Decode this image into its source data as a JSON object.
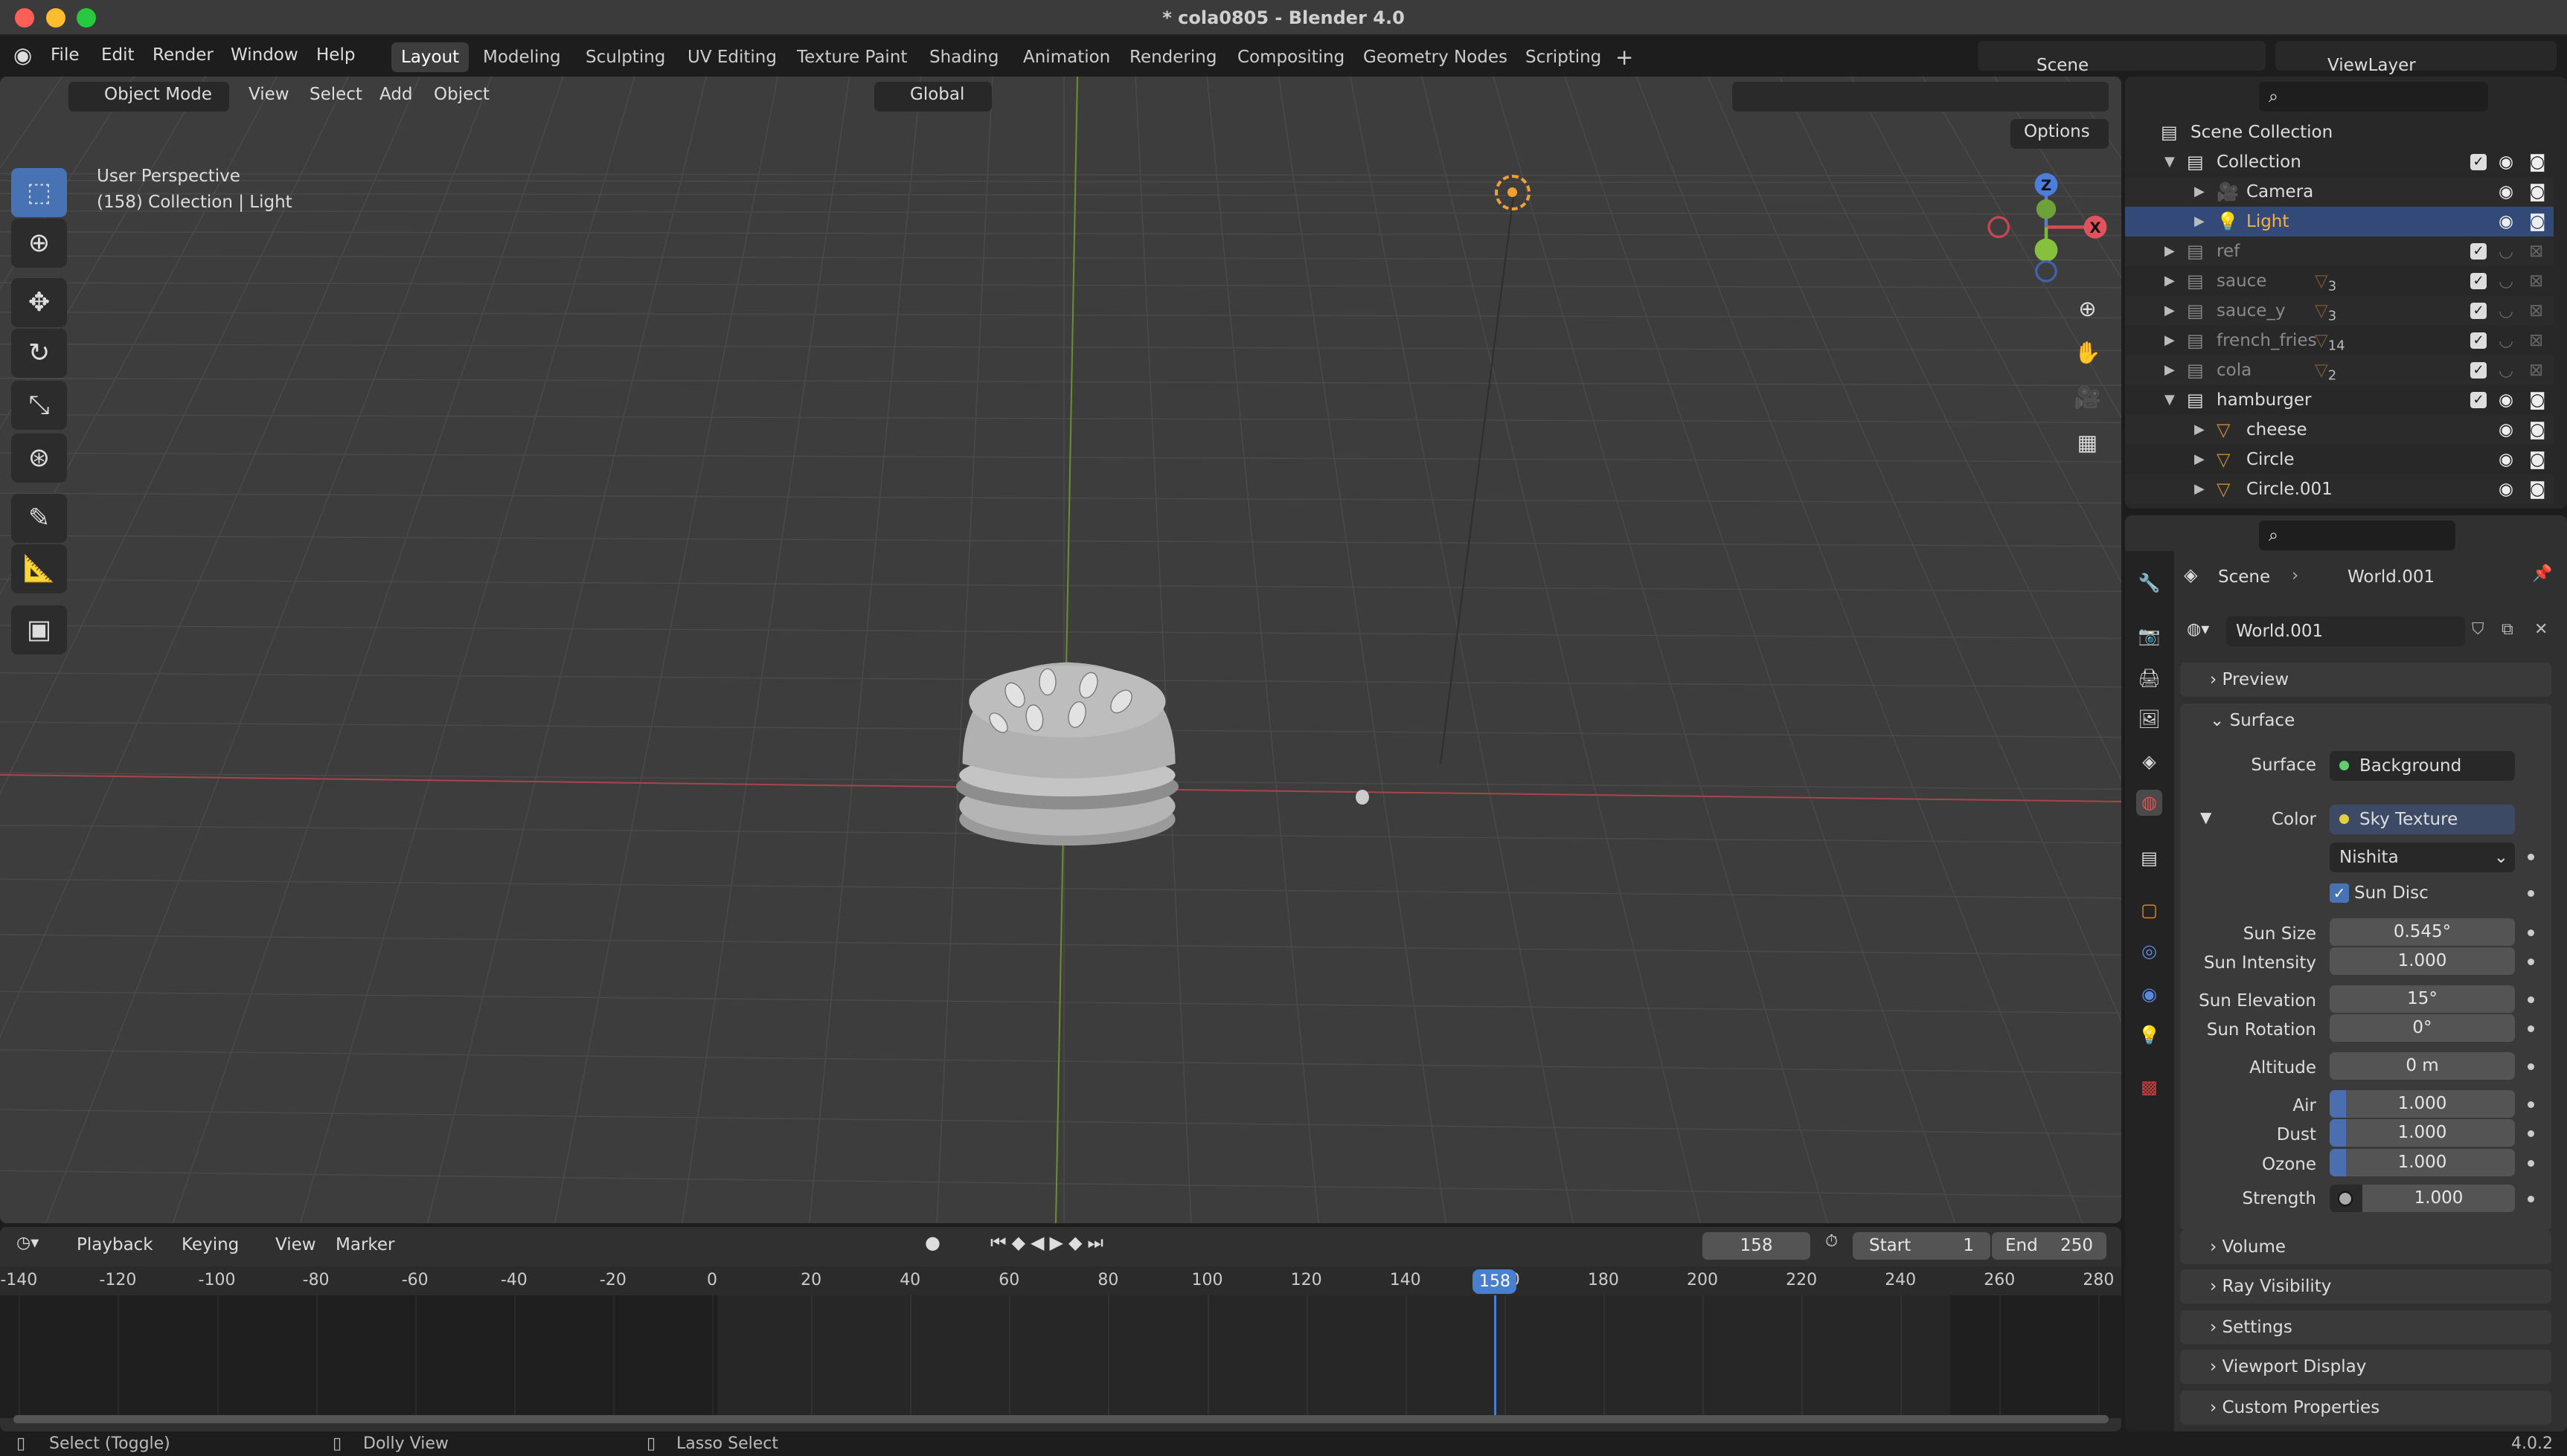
{
  "window": {
    "title": "* cola0805 - Blender 4.0",
    "traffic_lights": [
      "#ff5f57",
      "#febc2e",
      "#28c840"
    ]
  },
  "menu": {
    "items": [
      "File",
      "Edit",
      "Render",
      "Window",
      "Help"
    ],
    "workspaces": [
      "Layout",
      "Modeling",
      "Sculpting",
      "UV Editing",
      "Texture Paint",
      "Shading",
      "Animation",
      "Rendering",
      "Compositing",
      "Geometry Nodes",
      "Scripting"
    ],
    "active_workspace": "Layout",
    "add_workspace": "+",
    "scene": "Scene",
    "view_layer": "ViewLayer"
  },
  "viewport": {
    "mode": "Object Mode",
    "menus": [
      "View",
      "Select",
      "Add",
      "Object"
    ],
    "orientation": "Global",
    "options": "Options",
    "overlay_text": {
      "perspective": "User Perspective",
      "context": "(158) Collection | Light"
    },
    "gizmo": {
      "x": "X",
      "y": "Y",
      "z": "Z"
    },
    "tools": [
      "select-box",
      "cursor",
      "move",
      "rotate",
      "scale",
      "transform",
      "annotate",
      "measure",
      "add-cube"
    ]
  },
  "outliner": {
    "root": "Scene Collection",
    "rows": [
      {
        "name": "Collection",
        "type": "collection",
        "indent": 1,
        "expanded": true,
        "checked": true,
        "visible": true
      },
      {
        "name": "Camera",
        "type": "camera",
        "indent": 2,
        "visible": true
      },
      {
        "name": "Light",
        "type": "light",
        "indent": 2,
        "visible": true,
        "selected": true
      },
      {
        "name": "ref",
        "type": "collection",
        "indent": 1,
        "checked": true,
        "visible": false,
        "dim": true
      },
      {
        "name": "sauce",
        "type": "collection",
        "indent": 1,
        "checked": true,
        "visible": false,
        "dim": true,
        "count": "3"
      },
      {
        "name": "sauce_y",
        "type": "collection",
        "indent": 1,
        "checked": true,
        "visible": false,
        "dim": true,
        "count": "3"
      },
      {
        "name": "french_fries",
        "type": "collection",
        "indent": 1,
        "checked": true,
        "visible": false,
        "dim": true,
        "count": "14"
      },
      {
        "name": "cola",
        "type": "collection",
        "indent": 1,
        "checked": true,
        "visible": false,
        "dim": true,
        "count": "2"
      },
      {
        "name": "hamburger",
        "type": "collection",
        "indent": 1,
        "expanded": true,
        "checked": true,
        "visible": true
      },
      {
        "name": "cheese",
        "type": "mesh",
        "indent": 2,
        "visible": true
      },
      {
        "name": "Circle",
        "type": "mesh",
        "indent": 2,
        "visible": true
      },
      {
        "name": "Circle.001",
        "type": "mesh",
        "indent": 2,
        "visible": true
      }
    ]
  },
  "properties": {
    "breadcrumb": [
      "Scene",
      "World.001"
    ],
    "world_name": "World.001",
    "panels": {
      "preview": "Preview",
      "surface": "Surface",
      "volume": "Volume",
      "ray_visibility": "Ray Visibility",
      "settings": "Settings",
      "viewport_display": "Viewport Display",
      "custom_properties": "Custom Properties"
    },
    "surface": {
      "label": "Surface",
      "value": "Background",
      "color_label": "Color",
      "color_value": "Sky Texture",
      "sky_type": "Nishita",
      "sun_disc_label": "Sun Disc",
      "sun_disc": true,
      "fields": [
        {
          "label": "Sun Size",
          "value": "0.545°"
        },
        {
          "label": "Sun Intensity",
          "value": "1.000"
        },
        {
          "label": "Sun Elevation",
          "value": "15°"
        },
        {
          "label": "Sun Rotation",
          "value": "0°"
        },
        {
          "label": "Altitude",
          "value": "0 m"
        },
        {
          "label": "Air",
          "value": "1.000"
        },
        {
          "label": "Dust",
          "value": "1.000"
        },
        {
          "label": "Ozone",
          "value": "1.000"
        }
      ],
      "strength_label": "Strength",
      "strength": "1.000"
    }
  },
  "timeline": {
    "menus": [
      "Playback",
      "Keying",
      "View",
      "Marker"
    ],
    "current_frame": "158",
    "start_label": "Start",
    "start": "1",
    "end_label": "End",
    "end": "250",
    "ticks": [
      "-140",
      "-120",
      "-100",
      "-80",
      "-60",
      "-40",
      "-20",
      "0",
      "20",
      "40",
      "60",
      "80",
      "100",
      "120",
      "140",
      "160",
      "180",
      "200",
      "220",
      "240",
      "260",
      "280"
    ]
  },
  "status": {
    "items": [
      "Select (Toggle)",
      "Dolly View",
      "Lasso Select"
    ],
    "version": "4.0.2"
  }
}
